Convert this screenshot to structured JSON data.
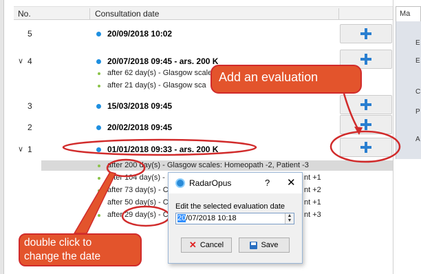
{
  "table": {
    "col_no": "No.",
    "col_date": "Consultation date"
  },
  "rows": [
    {
      "no": "5",
      "date": "20/09/2018 10:02",
      "expander": ""
    },
    {
      "no": "4",
      "date": "20/07/2018 09:45 - ars. 200 K",
      "expander": "∨"
    },
    {
      "no": "3",
      "date": "15/03/2018 09:45",
      "expander": ""
    },
    {
      "no": "2",
      "date": "20/02/2018 09:45",
      "expander": ""
    },
    {
      "no": "1",
      "date": "01/01/2018 09:33 - ars. 200 K",
      "expander": "∨"
    }
  ],
  "row4_evals": [
    "after 62 day(s) - Glasgow scale",
    "after 21 day(s) - Glasgow sca"
  ],
  "row1_evals": [
    "after 200 day(s) - Glasgow scales: Homeopath -2, Patient -3",
    "after 104 day(s) -",
    "after 73 day(s) - C",
    "after 50 day(s) - C",
    "after 29 day(s) - C"
  ],
  "row1_evals_right": [
    "nt +1",
    "nt +2",
    "nt +1",
    "nt +3"
  ],
  "right_tab": "Ma",
  "right_letters": [
    "E",
    "E",
    "C",
    "P",
    "A"
  ],
  "callouts": {
    "add_evaluation": "Add an evaluation",
    "double_click_line1": "double click to",
    "double_click_line2": "change the date"
  },
  "dialog": {
    "title": "RadarOpus",
    "help": "?",
    "close": "✕",
    "label": "Edit the selected evaluation date",
    "value_selected": "20",
    "value_rest": "/07/2018 10:18",
    "cancel": "Cancel",
    "save": "Save"
  },
  "colors": {
    "accent_blue": "#1e8fe0",
    "callout_red": "#d12b2b",
    "callout_fill": "#e3542c",
    "eval_dot": "#8bc34a"
  }
}
